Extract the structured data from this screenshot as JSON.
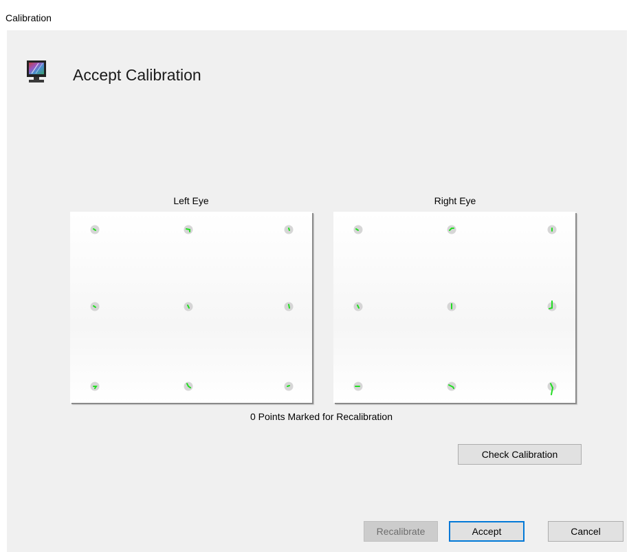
{
  "window": {
    "title": "Calibration"
  },
  "header": {
    "title": "Accept Calibration",
    "icon": "monitor-icon"
  },
  "left_eye": {
    "label": "Left Eye",
    "points": [
      {
        "row": 1,
        "col": 1
      },
      {
        "row": 1,
        "col": 2
      },
      {
        "row": 1,
        "col": 3
      },
      {
        "row": 2,
        "col": 1
      },
      {
        "row": 2,
        "col": 2
      },
      {
        "row": 2,
        "col": 3
      },
      {
        "row": 3,
        "col": 1
      },
      {
        "row": 3,
        "col": 2
      },
      {
        "row": 3,
        "col": 3
      }
    ]
  },
  "right_eye": {
    "label": "Right Eye",
    "points": [
      {
        "row": 1,
        "col": 1
      },
      {
        "row": 1,
        "col": 2
      },
      {
        "row": 1,
        "col": 3
      },
      {
        "row": 2,
        "col": 1
      },
      {
        "row": 2,
        "col": 2
      },
      {
        "row": 2,
        "col": 3
      },
      {
        "row": 3,
        "col": 1
      },
      {
        "row": 3,
        "col": 2
      },
      {
        "row": 3,
        "col": 3
      }
    ]
  },
  "status": {
    "text": "0 Points Marked for Recalibration"
  },
  "buttons": {
    "check": "Check Calibration",
    "recalibrate": "Recalibrate",
    "accept": "Accept",
    "cancel": "Cancel"
  },
  "colors": {
    "gaze_trace": "#22dd22",
    "target_dot": "#cfcfcf",
    "accept_border": "#0078d7"
  }
}
